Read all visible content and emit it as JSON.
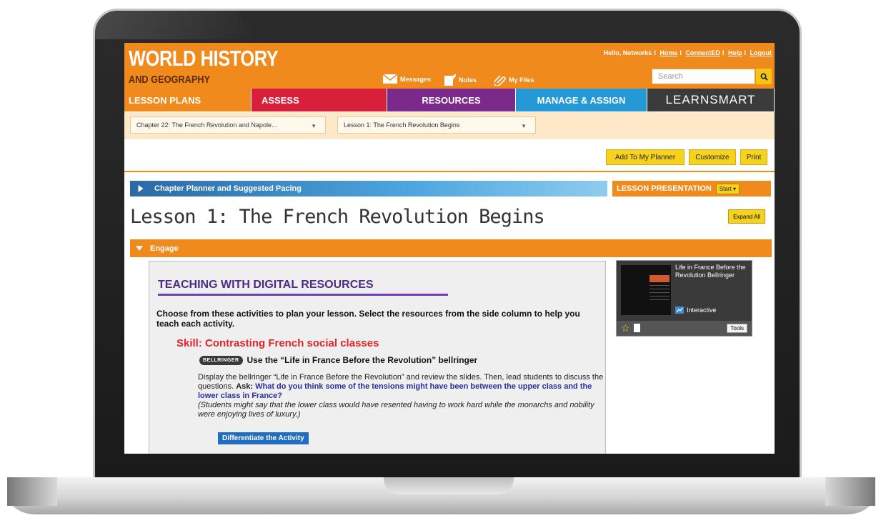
{
  "header": {
    "brand_title": "WORLD HISTORY",
    "brand_subtitle": "AND GEOGRAPHY",
    "greeting": "Hello, Networks",
    "links": [
      "Home",
      "ConnectED",
      "Help",
      "Logout"
    ],
    "messages_label": "Messages",
    "notes_label": "Notes",
    "myfiles_label": "My Files",
    "search_placeholder": "Search"
  },
  "nav": {
    "tabs": [
      {
        "label": "LESSON PLANS"
      },
      {
        "label": "ASSESS"
      },
      {
        "label": "RESOURCES"
      },
      {
        "label": "MANAGE & ASSIGN"
      },
      {
        "label": "LEARNSMART"
      }
    ]
  },
  "breadcrumbs": {
    "chapter": "Chapter 22: The French Revolution and Napole...",
    "lesson": "Lesson 1: The French Revolution Begins"
  },
  "actions": {
    "add_planner": "Add To My Planner",
    "customize": "Customize",
    "print": "Print"
  },
  "planner_bar": "Chapter Planner and Suggested Pacing",
  "lesson_presentation": {
    "label": "LESSON PRESENTATION",
    "start": "Start ▾"
  },
  "lesson_title": "Lesson 1: The French Revolution Begins",
  "expand_all": "Expand All",
  "engage_label": "Engage",
  "content": {
    "heading": "TEACHING WITH DIGITAL RESOURCES",
    "intro": "Choose from these activities to plan your lesson. Select the resources from the side column to help you teach each activity.",
    "skill": "Skill: Contrasting French social classes",
    "badge": "BELLRINGER",
    "bell_heading": "Use the “Life in France Before the Revolution” bellringer",
    "body_1": "Display the bellringer “Life in France Before the Revolution” and review the slides. Then, lead students to discuss the questions. ",
    "ask": "Ask:",
    "question": " What do you think some of the tensions might have been between the upper class and the lower class in France?",
    "note": "(Students might say that the lower class would have resented having to work hard while the monarchs and nobility were enjoying lives of luxury.)",
    "differentiate": "Differentiate the Activity"
  },
  "resource_card": {
    "title": "Life in France Before the Revolution Bellringer",
    "type": "Interactive",
    "tools": "Tools"
  },
  "colors": {
    "orange": "#f18a1d",
    "assess_red": "#d8203b",
    "resources_purple": "#7b2a8c",
    "manage_blue": "#2598d6",
    "learnsmart_dark": "#3b3b3b",
    "button_yellow": "#f6d21c"
  }
}
